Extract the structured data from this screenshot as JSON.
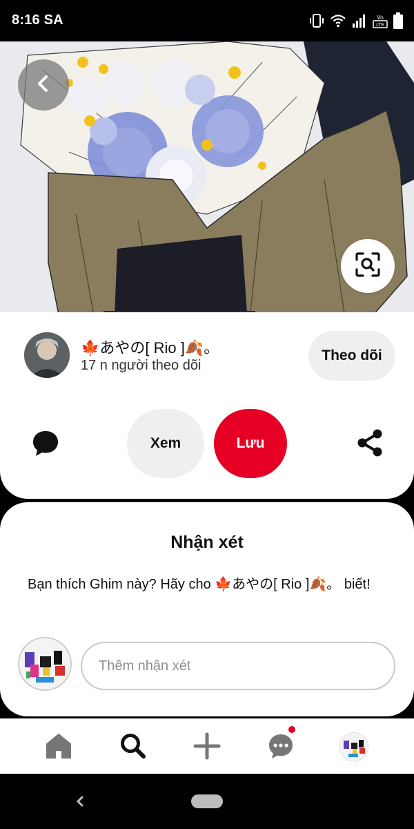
{
  "status_bar": {
    "time": "8:16 SA",
    "icons": [
      "vibrate-icon",
      "wifi-icon",
      "signal-icon",
      "volte-icon",
      "battery-icon"
    ]
  },
  "pin": {
    "image_description_icons": [
      "back-icon",
      "visual-search-icon"
    ]
  },
  "creator": {
    "name": "🍁あやの[ Rio ]🍂。",
    "followers": "17 n người theo dõi",
    "follow_label": "Theo dõi"
  },
  "actions": {
    "view_label": "Xem",
    "save_label": "Lưu"
  },
  "comments": {
    "title": "Nhận xét",
    "prompt": "Bạn thích Ghim này? Hãy cho 🍁あやの[ Rio ]🍂。 biết!",
    "input_placeholder": "Thêm nhận xét"
  },
  "bottom_nav": {
    "items": [
      "home-icon",
      "search-icon",
      "add-icon",
      "messages-icon",
      "profile-avatar"
    ],
    "has_notification": true
  },
  "colors": {
    "brand_red": "#e60023",
    "button_gray": "#efefef"
  }
}
